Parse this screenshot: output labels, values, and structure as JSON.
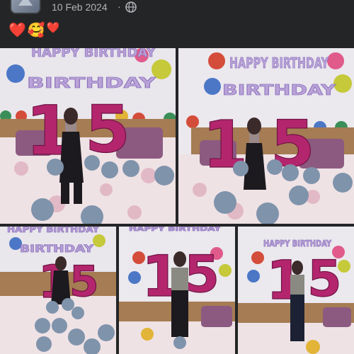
{
  "post": {
    "date": "10 Feb 2024",
    "separator": "·",
    "audience_icon": "globe-icon",
    "caption_emojis": [
      "❤️",
      "🥰",
      "❤️"
    ]
  },
  "photos": [
    {
      "id": "photo-1",
      "banner": "HAPPY BIRTHDAY",
      "balloon_digits": "15"
    },
    {
      "id": "photo-2",
      "banner": "HAPPY BIRTHDAY",
      "balloon_digits": "15"
    },
    {
      "id": "photo-3",
      "banner": "HAPPY BIRTHDAY",
      "balloon_digits": "15"
    },
    {
      "id": "photo-4",
      "banner": "HAPPY BIRTHDAY",
      "balloon_digits": "15"
    },
    {
      "id": "photo-5",
      "banner": "HAPPY BIRTHDAY",
      "balloon_digits": "15"
    }
  ],
  "colors": {
    "background": "#242526",
    "wall": "#ece9ee",
    "number_balloon": "#b3266d",
    "silver_balloon": "#7f93ab",
    "banner": "#b9a3d8"
  }
}
